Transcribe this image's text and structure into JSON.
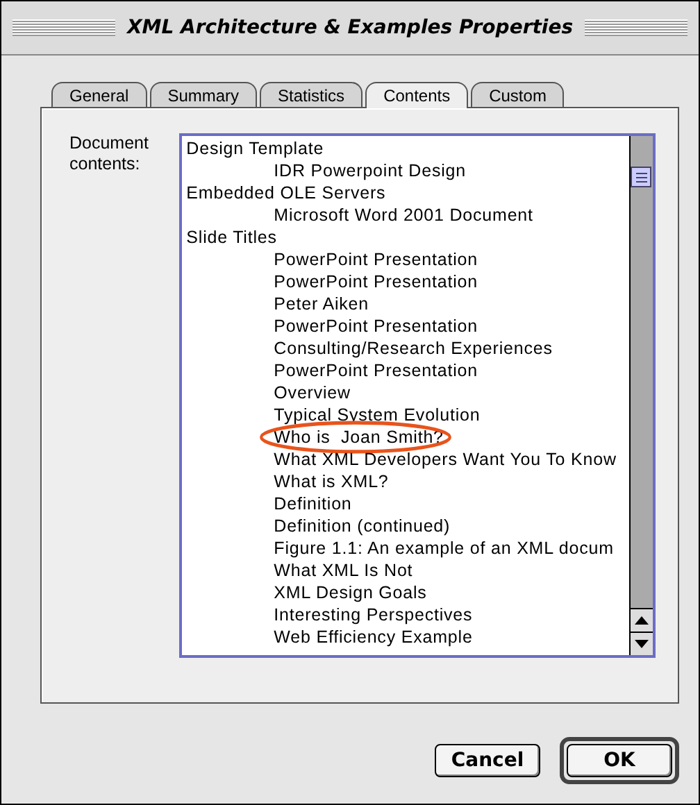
{
  "window": {
    "title": "XML Architecture & Examples Properties"
  },
  "tabs": [
    {
      "label": "General",
      "selected": false
    },
    {
      "label": "Summary",
      "selected": false
    },
    {
      "label": "Statistics",
      "selected": false
    },
    {
      "label": "Contents",
      "selected": true
    },
    {
      "label": "Custom",
      "selected": false
    }
  ],
  "contents": {
    "label": "Document contents:",
    "items": [
      {
        "text": "Design Template",
        "children": [
          {
            "text": "IDR Powerpoint Design",
            "circled": false
          }
        ]
      },
      {
        "text": "Embedded OLE Servers",
        "children": [
          {
            "text": "Microsoft Word 2001 Document",
            "circled": false
          }
        ]
      },
      {
        "text": "Slide Titles",
        "children": [
          {
            "text": "PowerPoint Presentation",
            "circled": false
          },
          {
            "text": "PowerPoint Presentation",
            "circled": false
          },
          {
            "text": "Peter Aiken",
            "circled": false
          },
          {
            "text": "PowerPoint Presentation",
            "circled": false
          },
          {
            "text": "Consulting/Research Experiences",
            "circled": false
          },
          {
            "text": "PowerPoint Presentation",
            "circled": false
          },
          {
            "text": "Overview",
            "circled": false
          },
          {
            "text": "Typical System Evolution",
            "circled": false
          },
          {
            "text": "Who is  Joan Smith?",
            "circled": true
          },
          {
            "text": "What XML Developers Want You To Know",
            "circled": false
          },
          {
            "text": "What is XML?",
            "circled": false
          },
          {
            "text": "Definition",
            "circled": false
          },
          {
            "text": "Definition (continued)",
            "circled": false
          },
          {
            "text": "Figure 1.1: An example of an XML docum",
            "circled": false
          },
          {
            "text": "What XML Is Not",
            "circled": false
          },
          {
            "text": "XML Design Goals",
            "circled": false
          },
          {
            "text": "Interesting Perspectives",
            "circled": false
          },
          {
            "text": "Web Efficiency Example",
            "circled": false
          }
        ]
      }
    ]
  },
  "buttons": [
    {
      "label": "Cancel",
      "default": false
    },
    {
      "label": "OK",
      "default": true
    }
  ]
}
